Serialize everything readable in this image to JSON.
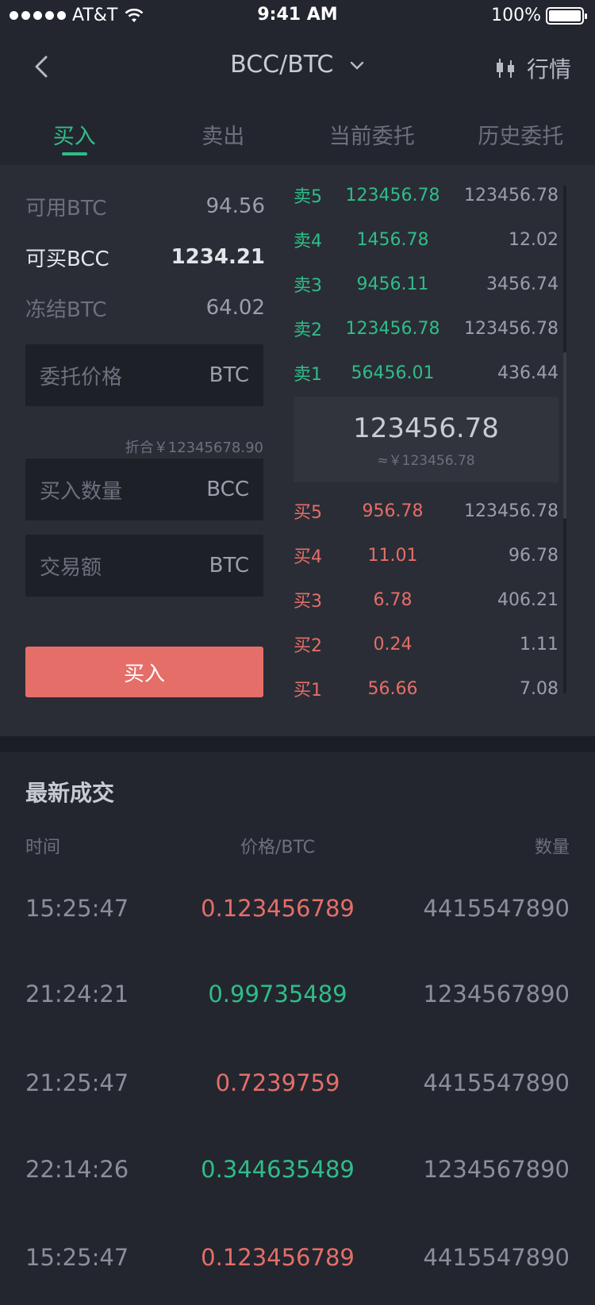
{
  "status_bar": {
    "carrier": "AT&T",
    "time": "9:41 AM",
    "battery": "100%"
  },
  "nav": {
    "title": "BCC/BTC",
    "market_label": "行情"
  },
  "tabs": [
    {
      "label": "买入",
      "active": true
    },
    {
      "label": "卖出",
      "active": false
    },
    {
      "label": "当前委托",
      "active": false
    },
    {
      "label": "历史委托",
      "active": false
    }
  ],
  "balances": [
    {
      "label": "可用BTC",
      "value": "94.56"
    },
    {
      "label": "可买BCC",
      "value": "1234.21"
    },
    {
      "label": "冻结BTC",
      "value": "64.02"
    }
  ],
  "form": {
    "price_placeholder": "委托价格",
    "price_unit": "BTC",
    "converted": "折合￥12345678.90",
    "amount_placeholder": "买入数量",
    "amount_unit": "BCC",
    "total_placeholder": "交易额",
    "total_unit": "BTC",
    "submit_label": "买入"
  },
  "order_book": {
    "asks": [
      {
        "label": "卖5",
        "price": "123456.78",
        "qty": "123456.78"
      },
      {
        "label": "卖4",
        "price": "1456.78",
        "qty": "12.02"
      },
      {
        "label": "卖3",
        "price": "9456.11",
        "qty": "3456.74"
      },
      {
        "label": "卖2",
        "price": "123456.78",
        "qty": "123456.78"
      },
      {
        "label": "卖1",
        "price": "56456.01",
        "qty": "436.44"
      }
    ],
    "last_price": "123456.78",
    "last_price_cny": "≈￥123456.78",
    "bids": [
      {
        "label": "买5",
        "price": "956.78",
        "qty": "123456.78"
      },
      {
        "label": "买4",
        "price": "11.01",
        "qty": "96.78"
      },
      {
        "label": "买3",
        "price": "6.78",
        "qty": "406.21"
      },
      {
        "label": "买2",
        "price": "0.24",
        "qty": "1.11"
      },
      {
        "label": "买1",
        "price": "56.66",
        "qty": "7.08"
      }
    ]
  },
  "trades": {
    "title": "最新成交",
    "headers": {
      "time": "时间",
      "price": "价格/BTC",
      "qty": "数量"
    },
    "rows": [
      {
        "time": "15:25:47",
        "price": "0.123456789",
        "qty": "4415547890",
        "dir": "up"
      },
      {
        "time": "21:24:21",
        "price": "0.99735489",
        "qty": "1234567890",
        "dir": "down"
      },
      {
        "time": "21:25:47",
        "price": "0.7239759",
        "qty": "4415547890",
        "dir": "up"
      },
      {
        "time": "22:14:26",
        "price": "0.344635489",
        "qty": "1234567890",
        "dir": "down"
      },
      {
        "time": "15:25:47",
        "price": "0.123456789",
        "qty": "4415547890",
        "dir": "up"
      }
    ]
  },
  "colors": {
    "up": "#e56e68",
    "down": "#2fbd87",
    "background": "#23262f"
  }
}
